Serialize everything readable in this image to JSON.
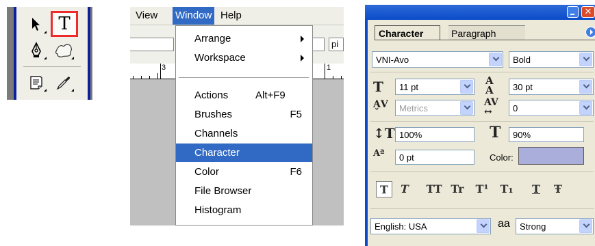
{
  "toolbox": {
    "tools": [
      {
        "name": "move-tool",
        "glyph": "➤"
      },
      {
        "name": "type-tool",
        "glyph": "T",
        "selected": true
      },
      {
        "name": "pen-tool",
        "glyph": "✒"
      },
      {
        "name": "custom-shape-tool",
        "glyph": "✧"
      },
      {
        "name": "notes-tool",
        "glyph": "📄"
      },
      {
        "name": "eyedropper-tool",
        "glyph": "✎"
      }
    ],
    "highlight_color": "#ee2a2a"
  },
  "menubar": {
    "view": "View",
    "window": "Window",
    "help": "Help"
  },
  "options": {
    "unit_field": "pi"
  },
  "ruler": {
    "left_num": "3",
    "right_num": "1"
  },
  "window_menu": {
    "arrange": "Arrange",
    "workspace": "Workspace",
    "actions": "Actions",
    "actions_shortcut": "Alt+F9",
    "brushes": "Brushes",
    "brushes_shortcut": "F5",
    "channels": "Channels",
    "character": "Character",
    "color": "Color",
    "color_shortcut": "F6",
    "file_browser": "File Browser",
    "histogram": "Histogram",
    "highlight_color": "#316ac5"
  },
  "character_palette": {
    "tab_character": "Character",
    "tab_paragraph": "Paragraph",
    "font_family": "VNI-Avo",
    "font_style": "Bold",
    "font_size": "11 pt",
    "leading": "30 pt",
    "kerning": "Metrics",
    "tracking": "0",
    "vertical_scale": "100%",
    "horizontal_scale": "90%",
    "baseline_shift": "0 pt",
    "color_label": "Color:",
    "color_value": "#a9aedb",
    "language": "English: USA",
    "antialias_icon": "aa",
    "antialias": "Strong",
    "style_buttons": [
      "T",
      "T",
      "TT",
      "Tr",
      "T¹",
      "T₁",
      "T",
      "Ŧ"
    ]
  }
}
